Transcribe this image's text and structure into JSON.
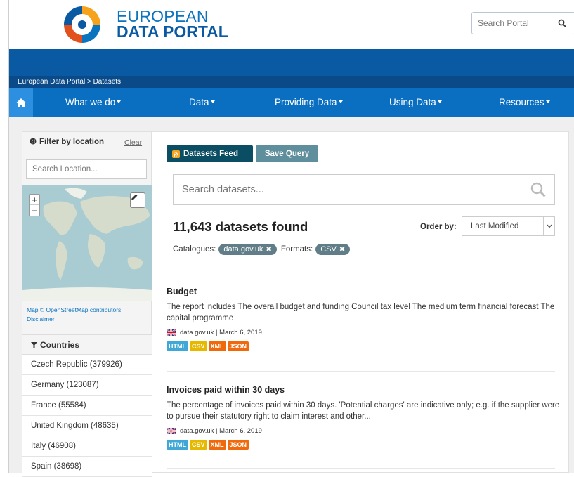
{
  "header": {
    "logo_line1": "EUROPEAN",
    "logo_line2": "DATA PORTAL",
    "search_placeholder": "Search Portal"
  },
  "breadcrumb": "European Data Portal > Datasets",
  "nav": {
    "items": [
      "What we do",
      "Data",
      "Providing Data",
      "Using Data",
      "Resources"
    ]
  },
  "filter": {
    "title": "Filter by location",
    "clear": "Clear",
    "location_placeholder": "Search Location...",
    "map_attribution": "Map © OpenStreetMap contributors",
    "disclaimer": "Disclaimer"
  },
  "countries": {
    "title": "Countries",
    "items": [
      "Czech Republic (379926)",
      "Germany (123087)",
      "France (55584)",
      "United Kingdom (48635)",
      "Italy (46908)",
      "Spain (38698)"
    ]
  },
  "toolbar": {
    "feed_label": "Datasets Feed",
    "save_label": "Save Query"
  },
  "search": {
    "placeholder": "Search datasets..."
  },
  "results": {
    "found": "11,643 datasets found",
    "order_label": "Order by:",
    "order_value": "Last Modified",
    "catalogues_label": "Catalogues:",
    "catalogue_pill": "data.gov.uk",
    "formats_label": "Formats:",
    "format_pill": "CSV"
  },
  "datasets": [
    {
      "title": "Budget",
      "description": "The report includes The overall budget and funding Council tax level The medium term financial forecast The capital programme",
      "meta": "data.gov.uk | March 6, 2019",
      "formats": [
        "HTML",
        "CSV",
        "XML",
        "JSON"
      ]
    },
    {
      "title": "Invoices paid within 30 days",
      "description": "The percentage of invoices paid within 30 days. 'Potential charges' are indicative only; e.g. if the supplier were to pursue their statutory right to claim interest and other...",
      "meta": "data.gov.uk | March 6, 2019",
      "formats": [
        "HTML",
        "CSV",
        "XML",
        "JSON"
      ]
    }
  ],
  "colors": {
    "brand_blue": "#0a5aa3",
    "nav_blue": "#0a6fc0",
    "feed_button": "#0b4d62",
    "save_button": "#5f8e9c",
    "pill": "#617d87",
    "html_badge": "#3fa8d6",
    "csv_badge": "#e6b800",
    "xml_badge": "#f06a0c",
    "json_badge": "#f06a0c"
  }
}
